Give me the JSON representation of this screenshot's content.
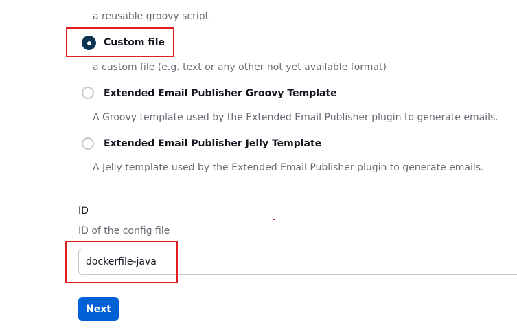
{
  "options": [
    {
      "label": "Custom file",
      "description": "a custom file (e.g. text or any other not yet available format)",
      "checked": true
    },
    {
      "label": "Extended Email Publisher Groovy Template",
      "description": "A Groovy template used by the Extended Email Publisher plugin to generate emails.",
      "checked": false
    },
    {
      "label": "Extended Email Publisher Jelly Template",
      "description": "A Jelly template used by the Extended Email Publisher plugin to generate emails.",
      "checked": false
    }
  ],
  "previous_option_description": "a reusable groovy script",
  "id_field": {
    "label": "ID",
    "help": "ID of the config file",
    "value": "dockerfile-java"
  },
  "next_button_label": "Next",
  "colors": {
    "accent": "#0060d6",
    "radio_checked": "#0b3553",
    "highlight": "#e02020"
  }
}
